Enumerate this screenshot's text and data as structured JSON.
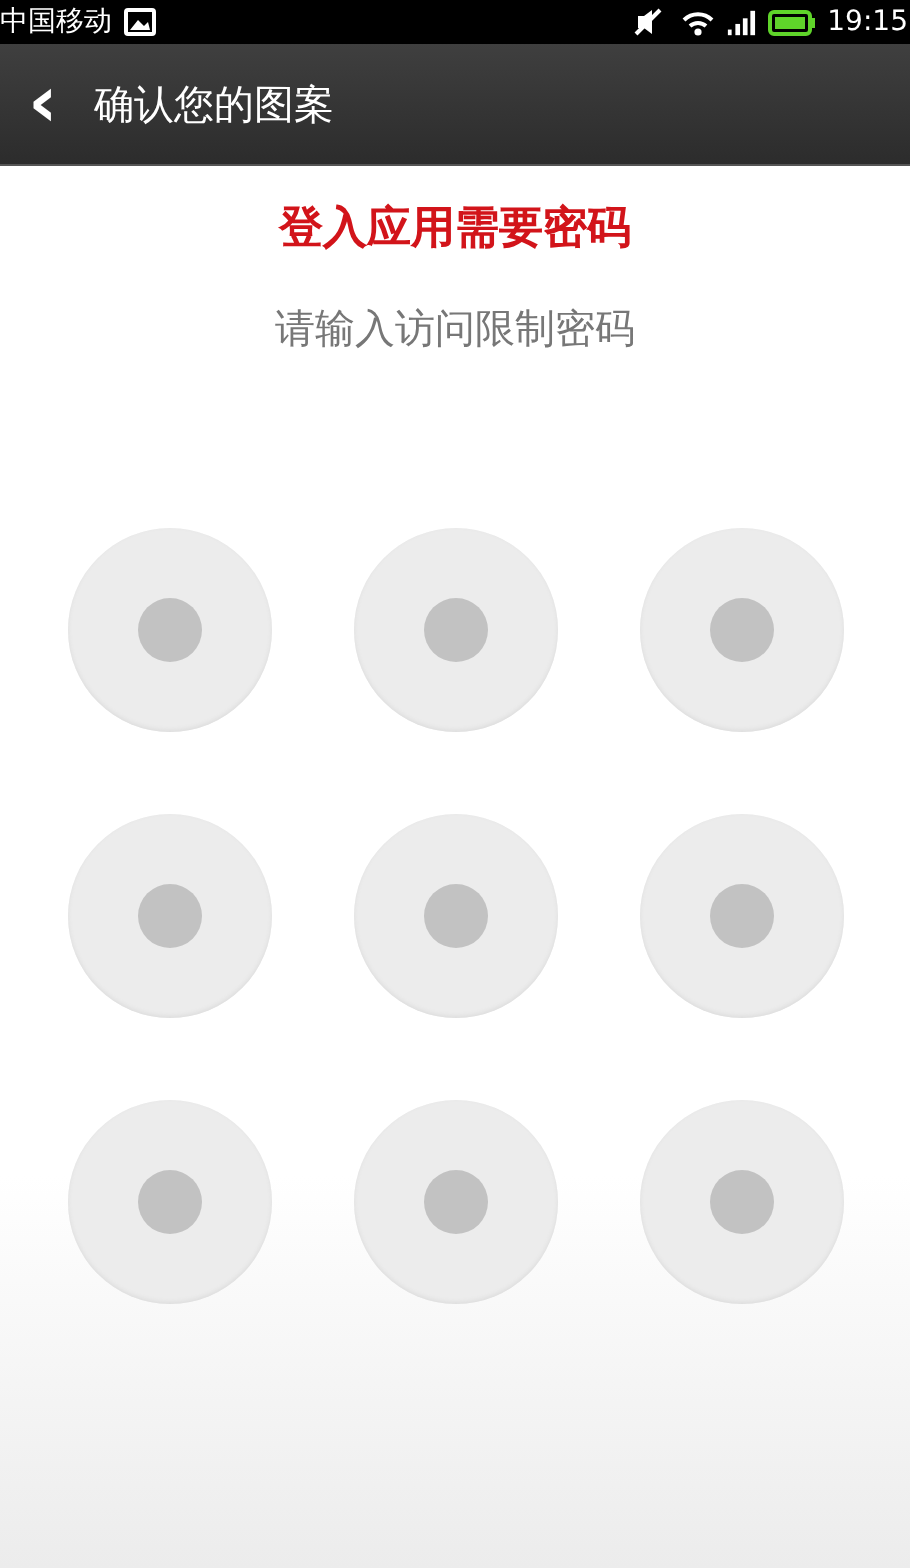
{
  "status_bar": {
    "carrier": "中国移动",
    "time": "19:15"
  },
  "title_bar": {
    "back": "‹",
    "title": "确认您的图案"
  },
  "heading": "登入应用需要密码",
  "hint": "请输入访问限制密码",
  "pattern": {
    "dots": [
      {
        "selected": false
      },
      {
        "selected": false
      },
      {
        "selected": false
      },
      {
        "selected": false
      },
      {
        "selected": false
      },
      {
        "selected": false
      },
      {
        "selected": false
      },
      {
        "selected": false
      },
      {
        "selected": false
      }
    ]
  }
}
